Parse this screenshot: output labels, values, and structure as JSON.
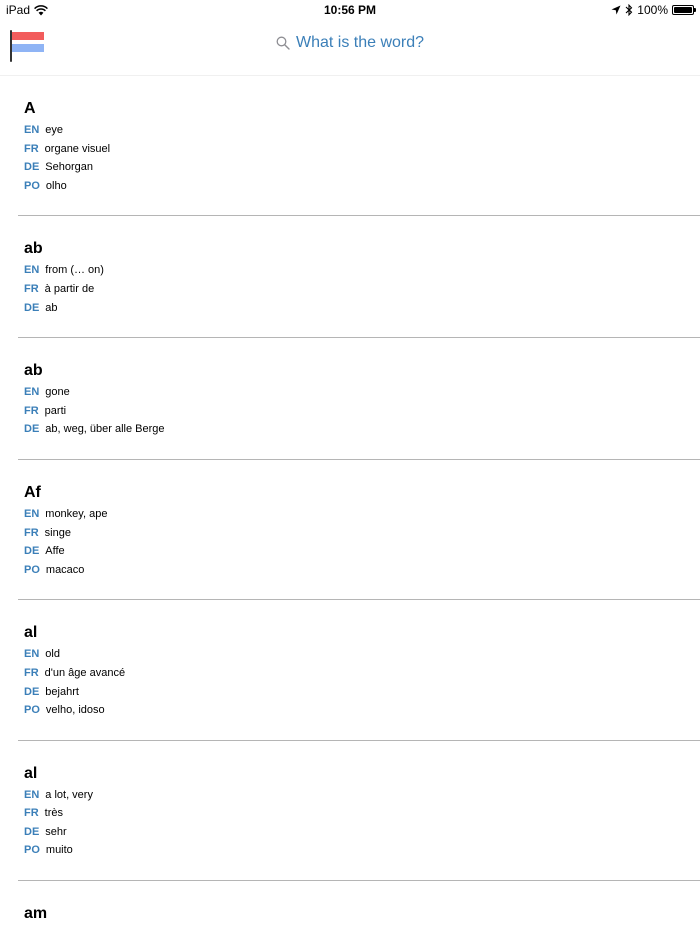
{
  "status_bar": {
    "carrier": "iPad",
    "time": "10:56 PM",
    "battery": "100%",
    "battery_level": 1.0,
    "icons": [
      "wifi-icon",
      "location-arrow-icon",
      "bluetooth-icon",
      "battery-icon"
    ]
  },
  "header": {
    "flag_colors": [
      "#f25c5c",
      "#ffffff",
      "#8fb4f5"
    ],
    "search_placeholder": "What is the word?",
    "accent": "#3b7fb8"
  },
  "entries": [
    {
      "word": "A",
      "translations": [
        {
          "lang": "EN",
          "text": "eye"
        },
        {
          "lang": "FR",
          "text": "organe visuel"
        },
        {
          "lang": "DE",
          "text": "Sehorgan"
        },
        {
          "lang": "PO",
          "text": "olho"
        }
      ]
    },
    {
      "word": "ab",
      "translations": [
        {
          "lang": "EN",
          "text": "from (… on)"
        },
        {
          "lang": "FR",
          "text": "à partir de"
        },
        {
          "lang": "DE",
          "text": "ab"
        }
      ]
    },
    {
      "word": "ab",
      "translations": [
        {
          "lang": "EN",
          "text": "gone"
        },
        {
          "lang": "FR",
          "text": "parti"
        },
        {
          "lang": "DE",
          "text": "ab, weg, über alle Berge"
        }
      ]
    },
    {
      "word": "Af",
      "translations": [
        {
          "lang": "EN",
          "text": "monkey, ape"
        },
        {
          "lang": "FR",
          "text": "singe"
        },
        {
          "lang": "DE",
          "text": "Affe"
        },
        {
          "lang": "PO",
          "text": "macaco"
        }
      ]
    },
    {
      "word": "al",
      "translations": [
        {
          "lang": "EN",
          "text": "old"
        },
        {
          "lang": "FR",
          "text": "d'un âge avancé"
        },
        {
          "lang": "DE",
          "text": "bejahrt"
        },
        {
          "lang": "PO",
          "text": "velho, idoso"
        }
      ]
    },
    {
      "word": "al",
      "translations": [
        {
          "lang": "EN",
          "text": "a lot, very"
        },
        {
          "lang": "FR",
          "text": "très"
        },
        {
          "lang": "DE",
          "text": "sehr"
        },
        {
          "lang": "PO",
          "text": "muito"
        }
      ]
    },
    {
      "word": "am",
      "translations": []
    }
  ]
}
